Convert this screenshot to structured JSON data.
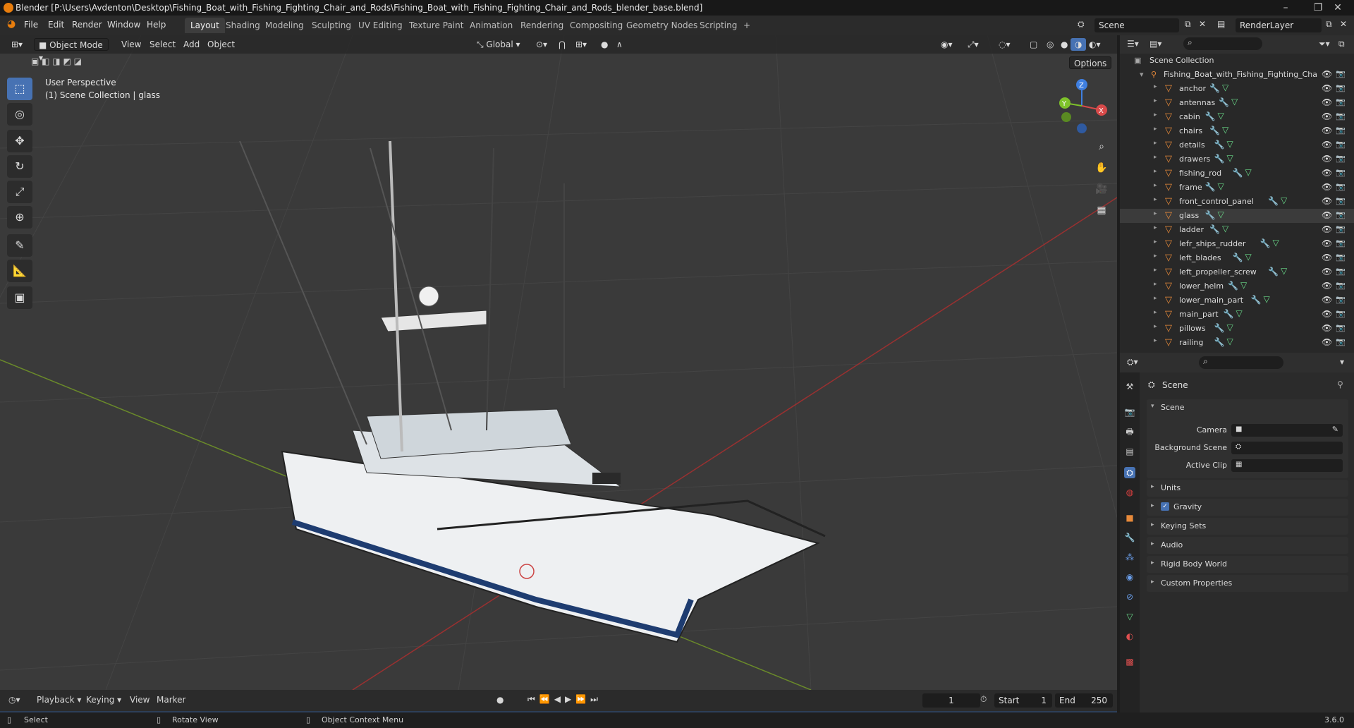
{
  "window": {
    "title": "Blender [P:\\Users\\Avdenton\\Desktop\\Fishing_Boat_with_Fishing_Fighting_Chair_and_Rods\\Fishing_Boat_with_Fishing_Fighting_Chair_and_Rods_blender_base.blend]",
    "minimize": "–",
    "maximize": "❐",
    "close": "✕"
  },
  "menubar": [
    "File",
    "Edit",
    "Render",
    "Window",
    "Help"
  ],
  "workspaces": [
    "Layout",
    "Shading",
    "Modeling",
    "Sculpting",
    "UV Editing",
    "Texture Paint",
    "Animation",
    "Rendering",
    "Compositing",
    "Geometry Nodes",
    "Scripting",
    "+"
  ],
  "scene_field": "Scene",
  "renderlayer_field": "RenderLayer",
  "viewport_header": {
    "mode": "Object Mode",
    "menus": [
      "View",
      "Select",
      "Add",
      "Object"
    ],
    "transform": "Global",
    "options": "Options"
  },
  "viewport": {
    "perspective": "User Perspective",
    "collection": "(1) Scene Collection | glass",
    "gizmo_x": "X",
    "gizmo_y": "Y",
    "gizmo_z": "Z"
  },
  "outliner": {
    "root": "Scene Collection",
    "collection": "Fishing_Boat_with_Fishing_Fighting_Cha",
    "items": [
      "anchor",
      "antennas",
      "cabin",
      "chairs",
      "details",
      "drawers",
      "fishing_rod",
      "frame",
      "front_control_panel",
      "glass",
      "ladder",
      "lefr_ships_rudder",
      "left_blades",
      "left_propeller_screw",
      "lower_helm",
      "lower_main_part",
      "main_part",
      "pillows",
      "railing"
    ],
    "selected": "glass"
  },
  "properties": {
    "header": "Scene",
    "section": "Scene",
    "camera_label": "Camera",
    "background_label": "Background Scene",
    "clip_label": "Active Clip",
    "panels": [
      "Units",
      "Gravity",
      "Keying Sets",
      "Audio",
      "Rigid Body World",
      "Custom Properties"
    ]
  },
  "timeline": {
    "menus": [
      "Playback",
      "Keying",
      "View",
      "Marker"
    ],
    "frame": "1",
    "start_label": "Start",
    "start": "1",
    "end_label": "End",
    "end": "250"
  },
  "statusbar": {
    "select": "Select",
    "rotate": "Rotate View",
    "context": "Object Context Menu",
    "version": "3.6.0"
  },
  "colors": {
    "accent": "#4772b3",
    "object": "#e88a3a",
    "mesh": "#6adb8a",
    "modifier": "#6a9eea"
  }
}
